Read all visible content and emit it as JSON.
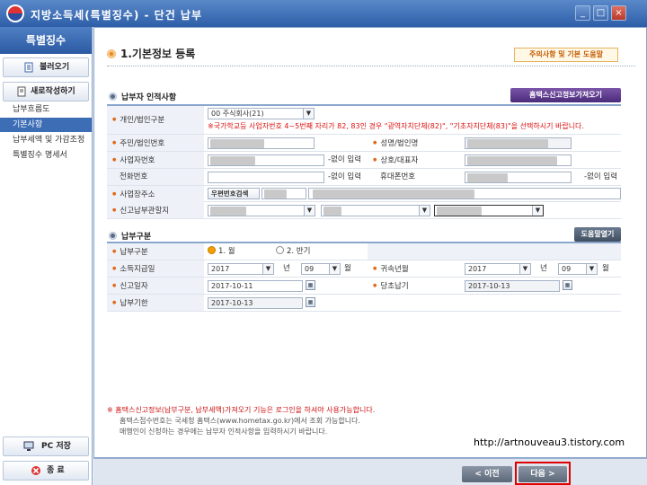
{
  "window": {
    "title": "지방소득세(특별징수) - 단건 납부",
    "min_label": "_",
    "max_label": "□",
    "close_label": "×"
  },
  "sidebar": {
    "title": "특별징수",
    "load_label": "불러오기",
    "new_label": "새로작성하기",
    "items": [
      "납부흐름도",
      "기본사항",
      "납부세액 및 가감조정",
      "특별징수 명세서"
    ],
    "pc_save_label": "PC 저장",
    "exit_label": "종 료"
  },
  "section": {
    "title": "1.기본정보 등록",
    "help_button": "주의사항 및 기본 도움말"
  },
  "payer": {
    "subtitle": "납부자 인적사항",
    "hometax_button": "홈택스신고정보가져오기",
    "labels": {
      "type": "개인/법인구분",
      "rrn": "주민/법인번호",
      "name": "성명/법인명",
      "bizno": "사업자번호",
      "company": "상호/대표자",
      "phone": "전화번호",
      "mobile": "휴대폰번호",
      "address": "사업장주소",
      "office": "신고납부관할지"
    },
    "type_value": "00 주식회사(21)",
    "warning": "※국가학교등 사업자번호 4~5번째 자리가 82, 83인 경우 \"광역자치단체(82)\", \"기초자치단체(83)\"을 선택하시기 바랍니다.",
    "no_dash": "-없이 입력",
    "zip_button": "우편번호검색"
  },
  "payment": {
    "subtitle": "납부구분",
    "help_button": "도움말열기",
    "labels": {
      "kind": "납부구분",
      "pay_month": "소득지급일",
      "attr_month": "귀속년월",
      "report_date": "신고일자",
      "payment_date": "당초납기",
      "due_date": "납부기한"
    },
    "kind_options": [
      "1. 월",
      "2. 반기"
    ],
    "kind_selected": "1. 월",
    "pay_year": "2017",
    "pay_month_val": "09",
    "attr_year": "2017",
    "attr_month_val": "09",
    "year_unit": "년",
    "month_unit": "월",
    "report_date_val": "2017-10-11",
    "payment_date_val": "2017-10-13",
    "due_date_val": "2017-10-13"
  },
  "notes": {
    "line1": "※ 홈택스신고정보(납부구분, 납부세액)가져오기 기능은 로그인을 하셔야 사용가능합니다.",
    "line2": "홈택스접수번호는 국세청 홈택스(www.hometax.go.kr)에서 조회 가능합니다.",
    "line3": "매행인이 신청하는 경우에는 납부자 인적사항을 입력하시기 바랍니다."
  },
  "watermark": "http://artnouveau3.tistory.com",
  "nav": {
    "prev": "< 이전",
    "next": "다음 >"
  },
  "colors": {
    "accent": "#3d6db5",
    "highlight_border": "#e00000",
    "warning": "#d11111"
  }
}
